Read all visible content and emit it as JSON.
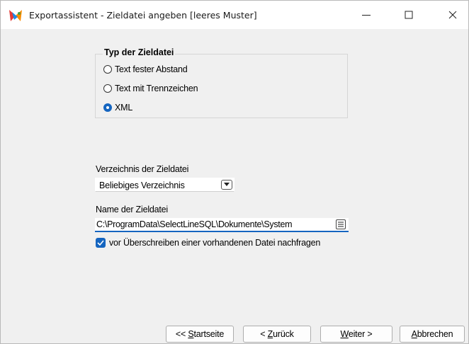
{
  "window": {
    "title": "Exportassistent - Zieldatei angeben [leeres Muster]",
    "icons": {
      "app": "export-wizard-icon",
      "minimize": "minimize-icon",
      "maximize": "maximize-icon",
      "close": "close-icon"
    }
  },
  "file_type_group": {
    "title": "Typ der Zieldatei",
    "options": [
      {
        "label": "Text fester Abstand",
        "selected": false
      },
      {
        "label": "Text mit Trennzeichen",
        "selected": false
      },
      {
        "label": "XML",
        "selected": true
      }
    ]
  },
  "directory": {
    "label": "Verzeichnis der Zieldatei",
    "selected_value": "Beliebiges Verzeichnis"
  },
  "filename": {
    "label": "Name der Zieldatei",
    "value": "C:\\ProgramData\\SelectLineSQL\\Dokumente\\System"
  },
  "overwrite_check": {
    "label": "vor Überschreiben einer vorhandenen Datei nachfragen",
    "checked": true
  },
  "buttons": {
    "start_prefix": "<< ",
    "start_ul": "S",
    "start_rest": "tartseite",
    "back_prefix": "< ",
    "back_ul": "Z",
    "back_rest": "urück",
    "next_ul": "W",
    "next_rest": "eiter >",
    "cancel_ul": "A",
    "cancel_rest": "bbrechen"
  },
  "colors": {
    "accent": "#1565c0",
    "background": "#f0f0f0"
  }
}
